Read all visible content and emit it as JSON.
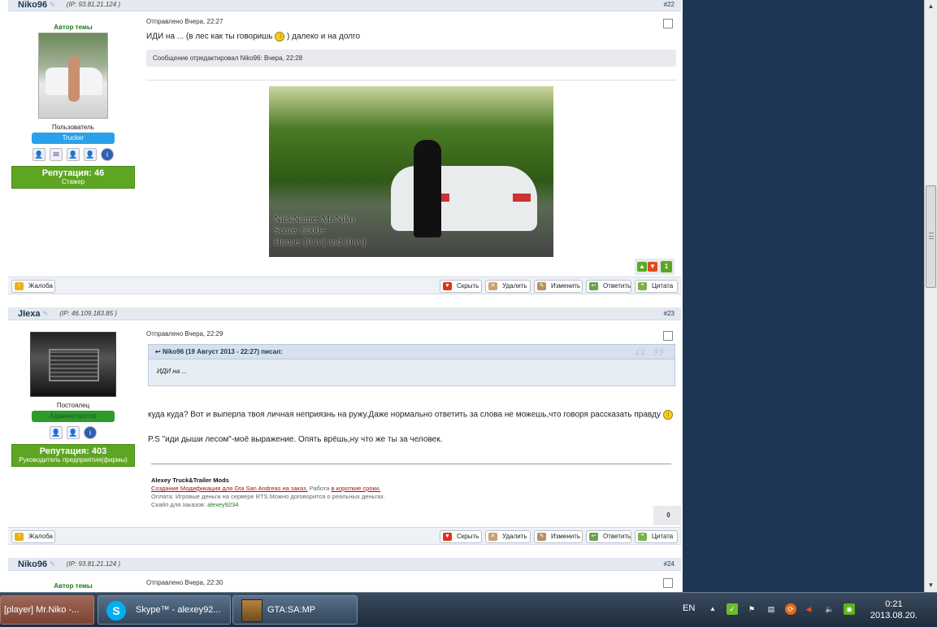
{
  "posts": [
    {
      "author": "Niko96",
      "ip": "(IP: 93.81.21.124 )",
      "number": "#22",
      "ts_label": "Автор темы",
      "group": "Пользователь",
      "group_badge": "Trucker",
      "reputation": "Репутация: 46",
      "rep_title": "Стажер",
      "sent": "Отправлено Вчера, 22:27",
      "message_before": "ИДИ на ... (в лес как ты говоришь",
      "message_after": ") далеко и на долго",
      "edited": "Сообщение отредактировал Niko96: Вчера, 22:28",
      "image_caption": [
        "NickName: Mr.Niko",
        "Score: 6500+",
        "House: [0.iv] and [0.iv]"
      ],
      "rating": "1"
    },
    {
      "author": "JIexa",
      "ip": "(IP: 46.109.183.85 )",
      "number": "#23",
      "group": "Постоялец",
      "group_badge": "Администратор",
      "reputation": "Репутация: 403",
      "rep_title": "Руководитель предприятия(фирмы)",
      "sent": "Отправлено Вчера, 22:29",
      "quote_head": "Niko96 (19 Август 2013 - 22:27) писал:",
      "quote_body": "ИДИ на ...",
      "message1": "куда куда? Вот и выперла твоя личная неприязнь на ружу.Даже нормально ответить за слова не можешь,что говоря рассказать правду",
      "message2": "P.S \"иди дыши лесом\"-моё выражение. Опять врёшь,ну что же ты за человек.",
      "sig_title": "Alexey Truck&Trailer Mods",
      "sig_link1": "Создание Модификация для Gta San Andreas на заказ.",
      "sig_mid": "Работа",
      "sig_link2": "в короткие сроки.",
      "sig_line2": "Оплата: Игровые деньги на сервере RTS.Можно договорится о реальных деньгах.",
      "sig_skype_label": "Скайп для заказов:",
      "sig_skype": "alexey9234",
      "rating": "0"
    },
    {
      "author": "Niko96",
      "ip": "(IP: 93.81.21.124 )",
      "number": "#24",
      "ts_label": "Автор темы",
      "sent": "Отправлено Вчера, 22:30"
    }
  ],
  "actions": {
    "report": "Жалоба",
    "hide": "Скрыть",
    "delete": "Удалить",
    "edit": "Изменить",
    "reply": "Ответить",
    "quote": "Цитата"
  },
  "taskbar": {
    "tasks": [
      "[player] Mr.Niko -...",
      "Skype™ - alexey92...",
      "GTA:SA:MP"
    ],
    "lang": "EN",
    "time": "0:21",
    "date": "2013.08.20."
  },
  "colors": {
    "accent": "#1d3652",
    "rep_green": "#5ea524",
    "trucker_blue": "#2aa1ea",
    "admin_green": "#2d9a2d"
  }
}
